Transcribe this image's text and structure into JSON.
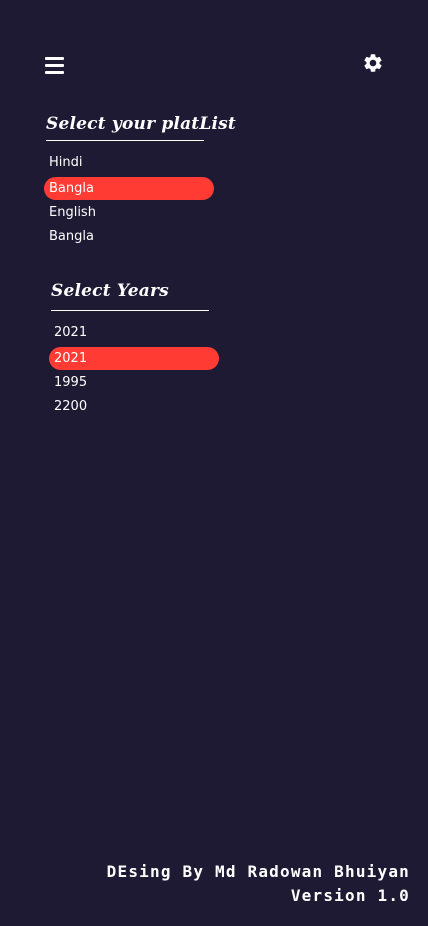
{
  "header": {
    "menu_icon": "hamburger-menu-icon",
    "settings_icon": "gear-icon"
  },
  "playlist_section": {
    "title": "Select your platList",
    "items": [
      {
        "label": "Hindi",
        "selected": false
      },
      {
        "label": "Bangla",
        "selected": true
      },
      {
        "label": "English",
        "selected": false
      },
      {
        "label": "Bangla",
        "selected": false
      }
    ]
  },
  "years_section": {
    "title": "Select Years",
    "items": [
      {
        "label": "2021",
        "selected": false
      },
      {
        "label": "2021",
        "selected": true
      },
      {
        "label": "1995",
        "selected": false
      },
      {
        "label": "2200",
        "selected": false
      }
    ]
  },
  "footer": {
    "credit": "DEsing By Md Radowan Bhuiyan",
    "version": "Version 1.0"
  },
  "colors": {
    "background": "#1e1a33",
    "accent": "#ff3b33",
    "text": "#ffffff"
  }
}
